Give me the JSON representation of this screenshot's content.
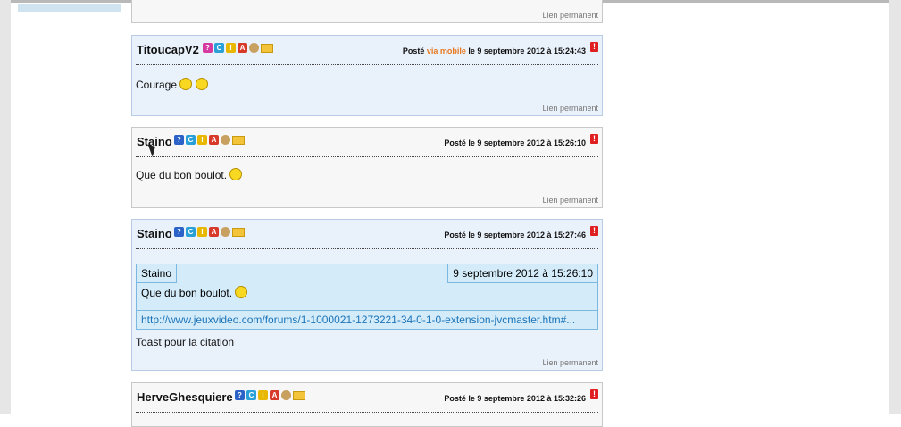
{
  "posts": [
    {
      "permalink": "Lien permanent"
    },
    {
      "author": "TitoucapV2",
      "meta_prefix": "Posté",
      "meta_mobile": "via mobile",
      "meta_date": "le 9 septembre 2012 à 15:24:43",
      "body": "Courage",
      "permalink": "Lien permanent"
    },
    {
      "author": "Staino",
      "meta": "Posté le 9 septembre 2012 à 15:26:10",
      "body": "Que du bon boulot.",
      "permalink": "Lien permanent"
    },
    {
      "author": "Staino",
      "meta": "Posté le 9 septembre 2012 à 15:27:46",
      "quote": {
        "author": "Staino",
        "date": "9 septembre 2012 à 15:26:10",
        "text": "Que du bon boulot.",
        "link": "http://www.jeuxvideo.com/forums/1-1000021-1273221-34-0-1-0-extension-jvcmaster.htm#..."
      },
      "body": "Toast pour la citation",
      "permalink": "Lien permanent"
    },
    {
      "author": "HerveGhesquiere",
      "meta": "Posté le 9 septembre 2012 à 15:32:26"
    }
  ],
  "badges": [
    "?",
    "C",
    "I",
    "A"
  ],
  "alert_icon": "!",
  "colors": {
    "link": "#1c74b8",
    "mobile": "#e8781e",
    "quote_bg": "#d4ecfa"
  }
}
